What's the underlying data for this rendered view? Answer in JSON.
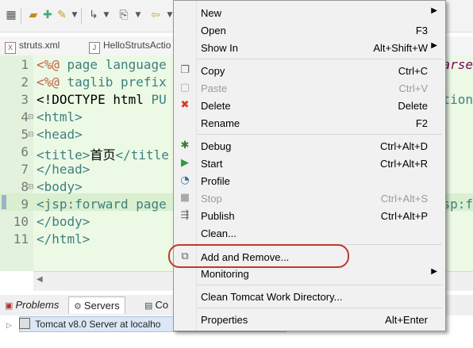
{
  "editor_tabs": [
    "struts.xml",
    "HelloStrutsActio"
  ],
  "code_lines": [
    {
      "num": "1",
      "parts": [
        [
          "c1",
          "<%@ "
        ],
        [
          "c2",
          "page "
        ],
        [
          "c2",
          "language"
        ]
      ],
      "right": "arse"
    },
    {
      "num": "2",
      "parts": [
        [
          "c1",
          "<%@ "
        ],
        [
          "c2",
          "taglib "
        ],
        [
          "c2",
          "prefix"
        ]
      ],
      "right": ""
    },
    {
      "num": "3",
      "parts": [
        [
          "c3",
          "<!DOCTYPE "
        ],
        [
          "c3",
          "html "
        ],
        [
          "c2",
          "PU"
        ]
      ],
      "right": "ction"
    },
    {
      "num": "4",
      "parts": [
        [
          "c2",
          "<html>"
        ]
      ],
      "right": ""
    },
    {
      "num": "5",
      "parts": [
        [
          "c2",
          "<head>"
        ]
      ],
      "right": ""
    },
    {
      "num": "6",
      "parts": [
        [
          "c2",
          "<title>"
        ],
        [
          "c3",
          "首页"
        ],
        [
          "c2",
          "</title"
        ]
      ],
      "right": ""
    },
    {
      "num": "7",
      "parts": [
        [
          "c2",
          "</head>"
        ]
      ],
      "right": ""
    },
    {
      "num": "8",
      "parts": [
        [
          "c2",
          "<body>"
        ]
      ],
      "right": ""
    },
    {
      "num": "9",
      "parts": [
        [
          "c2",
          "<jsp:forward "
        ],
        [
          "c2",
          "page"
        ]
      ],
      "right": "sp:f"
    },
    {
      "num": "10",
      "parts": [
        [
          "c2",
          "</body>"
        ]
      ],
      "right": ""
    },
    {
      "num": "11",
      "parts": [
        [
          "c2",
          "</html>"
        ]
      ],
      "right": ""
    }
  ],
  "bottom_tabs": {
    "problems": "Problems",
    "servers": "Servers",
    "console": "Co"
  },
  "server_row": "Tomcat v8.0 Server at localho",
  "context_menu": {
    "new": {
      "label": "New"
    },
    "open": {
      "label": "Open",
      "shortcut": "F3"
    },
    "show_in": {
      "label": "Show In",
      "shortcut": "Alt+Shift+W"
    },
    "copy": {
      "label": "Copy",
      "shortcut": "Ctrl+C"
    },
    "paste": {
      "label": "Paste",
      "shortcut": "Ctrl+V"
    },
    "delete": {
      "label": "Delete",
      "shortcut": "Delete"
    },
    "rename": {
      "label": "Rename",
      "shortcut": "F2"
    },
    "debug": {
      "label": "Debug",
      "shortcut": "Ctrl+Alt+D"
    },
    "start": {
      "label": "Start",
      "shortcut": "Ctrl+Alt+R"
    },
    "profile": {
      "label": "Profile"
    },
    "stop": {
      "label": "Stop",
      "shortcut": "Ctrl+Alt+S"
    },
    "publish": {
      "label": "Publish",
      "shortcut": "Ctrl+Alt+P"
    },
    "clean": {
      "label": "Clean..."
    },
    "add_remove": {
      "label": "Add and Remove..."
    },
    "monitoring": {
      "label": "Monitoring"
    },
    "clean_tomcat": {
      "label": "Clean Tomcat Work Directory..."
    },
    "properties": {
      "label": "Properties",
      "shortcut": "Alt+Enter"
    }
  },
  "colors": {
    "highlight_oval": "#c0392b",
    "editor_bg": "#ebf9e5",
    "menu_bg": "#f1f1f1"
  }
}
